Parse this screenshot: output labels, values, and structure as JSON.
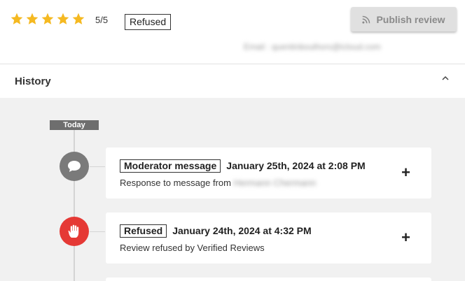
{
  "review": {
    "rating_text": "5/5",
    "stars_filled": 5,
    "star_color": "#f5b921",
    "status": "Refused",
    "publish_label": "Publish review",
    "email_text": "Email : quentinbouthors@icloud.com"
  },
  "history": {
    "title": "History",
    "today_label": "Today",
    "events": [
      {
        "badge": "Moderator message",
        "date": "January 25th, 2024 at 2:08 PM",
        "description": "Response to message from",
        "description_blurred": "Hermann Chermann",
        "icon": "chat-bubble-icon",
        "icon_color": "#7a7a7a"
      },
      {
        "badge": "Refused",
        "date": "January 24th, 2024 at 4:32 PM",
        "description": "Review refused by Verified Reviews",
        "icon": "stop-hand-icon",
        "icon_color": "#e53935"
      }
    ]
  },
  "colors": {
    "background": "#f1f1f1",
    "card": "#ffffff",
    "button_disabled": "#e0e0e0"
  }
}
